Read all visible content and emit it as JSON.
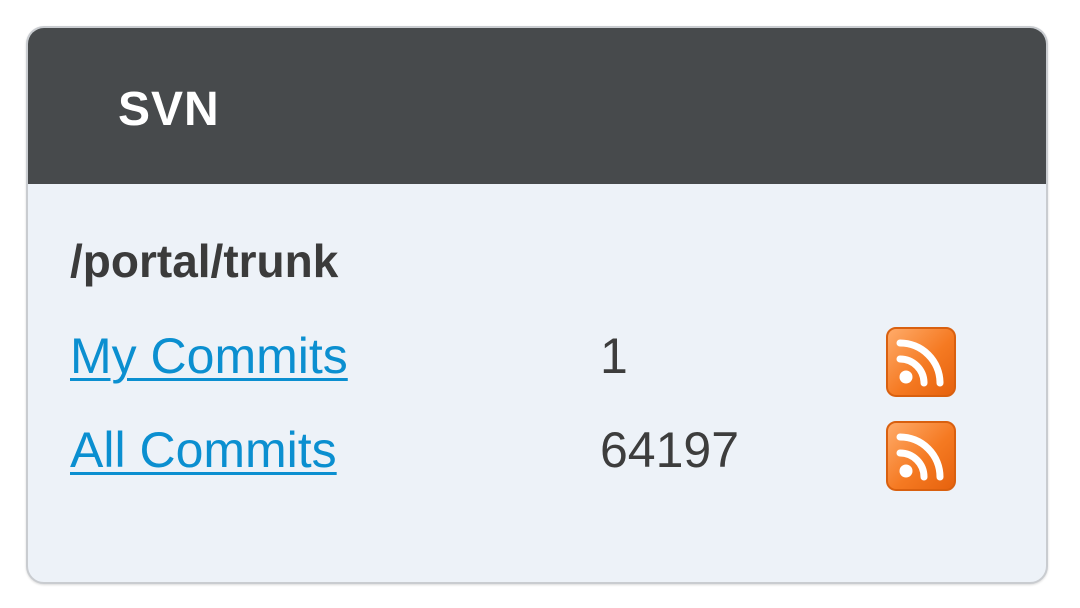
{
  "portlet": {
    "title": "SVN"
  },
  "repository": {
    "path": "/portal/trunk"
  },
  "rows": [
    {
      "label": "My Commits",
      "count": "1",
      "icon": "rss-feed-icon"
    },
    {
      "label": "All Commits",
      "count": "64197",
      "icon": "rss-feed-icon"
    }
  ],
  "colors": {
    "header_bg": "#474a4c",
    "body_bg": "#edf2f8",
    "link": "#0b8fd0",
    "rss_orange": "#f57a22"
  }
}
